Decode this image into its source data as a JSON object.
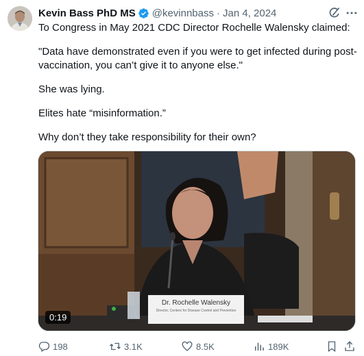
{
  "author": {
    "name": "Kevin Bass PhD MS",
    "handle": "@kevinnbass",
    "separator": "·",
    "date": "Jan 4, 2024"
  },
  "tweet": {
    "paragraphs": [
      "To Congress in May 2021 CDC Director Rochelle Walensky claimed:",
      "\"Data have demonstrated even if you were to get infected during post-vaccination, you can’t give it to anyone else.\"",
      "She was lying.",
      "Elites hate “misinformation.”",
      "Why don’t they take responsibility for their own?"
    ]
  },
  "media": {
    "duration": "0:19",
    "placard_name": "Dr. Rochelle Walensky",
    "placard_subtitle": "Director, Centers for Disease Control and Prevention"
  },
  "actions": {
    "replies": "198",
    "retweets": "3.1K",
    "likes": "8.5K",
    "views": "189K"
  },
  "colors": {
    "text": "#0f1419",
    "secondary": "#536471",
    "verified": "#1d9bf0"
  }
}
